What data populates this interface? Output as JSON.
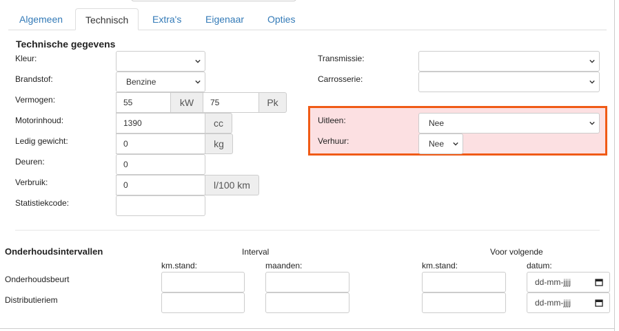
{
  "tabs": [
    {
      "label": "Algemeen",
      "active": false
    },
    {
      "label": "Technisch",
      "active": true
    },
    {
      "label": "Extra's",
      "active": false
    },
    {
      "label": "Eigenaar",
      "active": false
    },
    {
      "label": "Opties",
      "active": false
    }
  ],
  "section_title": "Technische gegevens",
  "left": {
    "kleur": {
      "label": "Kleur:",
      "value": ""
    },
    "brandstof": {
      "label": "Brandstof:",
      "value": "Benzine"
    },
    "vermogen": {
      "label": "Vermogen:",
      "kw_value": "55",
      "kw_unit": "kW",
      "pk_value": "75",
      "pk_unit": "Pk"
    },
    "motorinhoud": {
      "label": "Motorinhoud:",
      "value": "1390",
      "unit": "cc"
    },
    "ledig_gewicht": {
      "label": "Ledig gewicht:",
      "value": "0",
      "unit": "kg"
    },
    "deuren": {
      "label": "Deuren:",
      "value": "0"
    },
    "verbruik": {
      "label": "Verbruik:",
      "value": "0",
      "unit": "l/100 km"
    },
    "statistiekcode": {
      "label": "Statistiekcode:",
      "value": ""
    }
  },
  "right": {
    "transmissie": {
      "label": "Transmissie:",
      "value": ""
    },
    "carrosserie": {
      "label": "Carrosserie:",
      "value": ""
    },
    "uitleen": {
      "label": "Uitleen:",
      "value": "Nee"
    },
    "verhuur": {
      "label": "Verhuur:",
      "value": "Nee"
    }
  },
  "highlight_color": "#f05a15",
  "maintenance": {
    "title": "Onderhoudsintervallen",
    "interval_header": "Interval",
    "next_header": "Voor volgende",
    "col_km": "km.stand:",
    "col_months": "maanden:",
    "col_km_next": "km.stand:",
    "col_date": "datum:",
    "rows": [
      {
        "label": "Onderhoudsbeurt",
        "date_placeholder": "dd-mm-jjjj"
      },
      {
        "label": "Distributieriem",
        "date_placeholder": "dd-mm-jjjj"
      }
    ]
  },
  "icons": {
    "chevron": "chevron-down-icon",
    "calendar": "calendar-icon"
  }
}
